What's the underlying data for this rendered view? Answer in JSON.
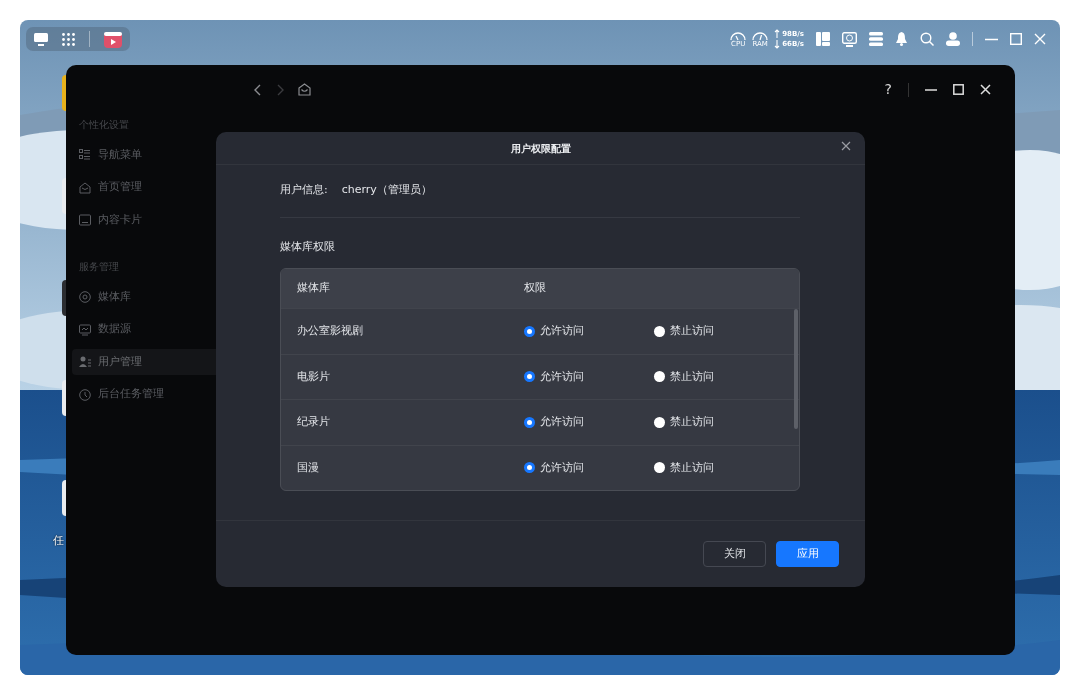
{
  "desktop_icons": [
    {
      "color": "#e8b21c"
    },
    {
      "color": "#e9ecef"
    },
    {
      "color": "#2b2d31"
    },
    {
      "color": "#e9ecef"
    },
    {
      "color": "#e9ecef",
      "label": "任"
    }
  ],
  "top_bar": {
    "gauges": [
      {
        "label": "CPU"
      },
      {
        "label": "RAM"
      }
    ],
    "upload_speed": "98B/s",
    "download_speed": "66B/s"
  },
  "app_window": {
    "help": "?",
    "sidebar": [
      {
        "title": "个性化设置",
        "items": [
          {
            "label": "导航菜单",
            "selected": false
          },
          {
            "label": "首页管理",
            "selected": false
          },
          {
            "label": "内容卡片",
            "selected": false
          }
        ]
      },
      {
        "title": "服务管理",
        "items": [
          {
            "label": "媒体库",
            "selected": false
          },
          {
            "label": "数据源",
            "selected": false
          },
          {
            "label": "用户管理",
            "selected": true
          },
          {
            "label": "后台任务管理",
            "selected": false
          }
        ]
      }
    ]
  },
  "dialog": {
    "title": "用户权限配置",
    "user_info_label": "用户信息:",
    "user_info_value": "cherry（管理员）",
    "section_title": "媒体库权限",
    "columns": [
      "媒体库",
      "权限"
    ],
    "rows": [
      {
        "name": "办公室影视剧",
        "options": [
          {
            "label": "允许访问",
            "selected": true
          },
          {
            "label": "禁止访问",
            "selected": false
          }
        ]
      },
      {
        "name": "电影片",
        "options": [
          {
            "label": "允许访问",
            "selected": true
          },
          {
            "label": "禁止访问",
            "selected": false
          }
        ]
      },
      {
        "name": "纪录片",
        "options": [
          {
            "label": "允许访问",
            "selected": true
          },
          {
            "label": "禁止访问",
            "selected": false
          }
        ]
      },
      {
        "name": "国漫",
        "options": [
          {
            "label": "允许访问",
            "selected": true
          },
          {
            "label": "禁止访问",
            "selected": false
          }
        ]
      }
    ],
    "buttons": [
      {
        "label": "关闭",
        "kind": "secondary"
      },
      {
        "label": "应用",
        "kind": "primary"
      }
    ]
  }
}
